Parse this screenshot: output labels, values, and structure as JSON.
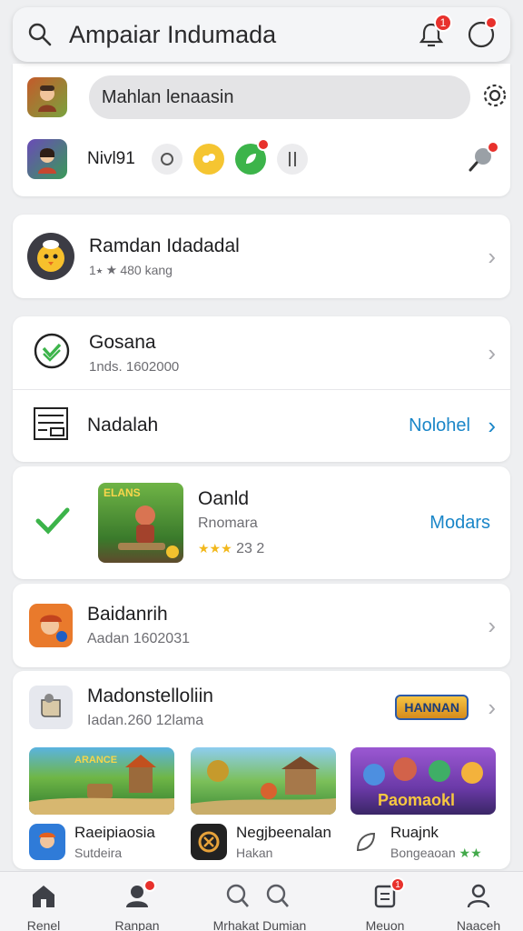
{
  "header": {
    "title": "Ampaiar Indumada",
    "notifications_badge": "1"
  },
  "profile": {
    "search_value": "Mahlan lenaasin",
    "level_label": "Nivl91"
  },
  "featured": {
    "name": "Ramdan Idadadal",
    "meta": "1⭑ ★ 480 kang"
  },
  "list_items": [
    {
      "name": "Gosana",
      "meta": "1nds. 1602000"
    },
    {
      "name": "Nadalah",
      "link": "Nolohel"
    }
  ],
  "game_card": {
    "thumb_label": "ELANS",
    "name": "Oanld",
    "genre": "Rnomara",
    "rating": "23 2",
    "action": "Modars"
  },
  "player_row": {
    "name": "Baidanrih",
    "meta": "Aadan 1602031"
  },
  "collection": {
    "name": "Madonstelloliin",
    "meta": "Iadan.260 12lama",
    "banner": "HANNAN",
    "items": [
      {
        "name": "Raeipiaosia",
        "sub": "Sutdeira",
        "thumb": "ARANCE"
      },
      {
        "name": "Negjbeenalan",
        "sub": "Hakan"
      },
      {
        "name": "Ruajnk",
        "sub": "Bongeaoan",
        "thumb": "Paomaokl"
      }
    ]
  },
  "bottom_nav": [
    {
      "label": "Renel"
    },
    {
      "label": "Ranpan"
    },
    {
      "label": "Mrhakat Dumian"
    },
    {
      "label": "Meuon"
    },
    {
      "label": "Naaceh"
    }
  ],
  "colors": {
    "accent": "#1a86c8",
    "badge": "#e8312c",
    "star": "#f2b81c",
    "green": "#42a94a"
  }
}
